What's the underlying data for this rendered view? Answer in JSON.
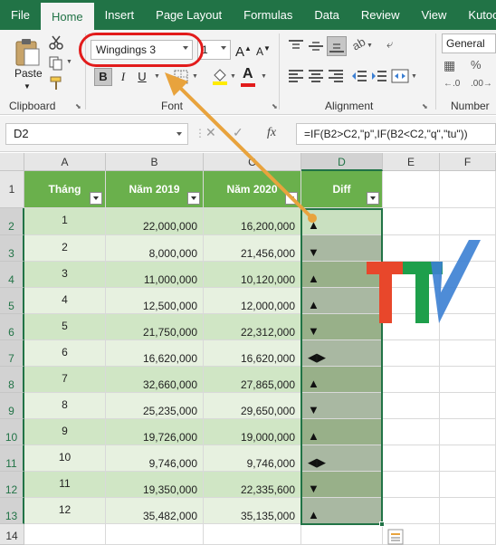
{
  "ribbon": {
    "tabs": [
      "File",
      "Home",
      "Insert",
      "Page Layout",
      "Formulas",
      "Data",
      "Review",
      "View",
      "Kutools"
    ],
    "active_tab": "Home",
    "clipboard": {
      "paste_label": "Paste",
      "group_label": "Clipboard"
    },
    "font": {
      "font_name": "Wingdings 3",
      "font_size": "1",
      "group_label": "Font",
      "bold": "B",
      "italic": "I",
      "underline": "U"
    },
    "alignment": {
      "group_label": "Alignment"
    },
    "number": {
      "format": "General",
      "group_label": "Number"
    }
  },
  "formula_bar": {
    "name_box": "D2",
    "fx": "fx",
    "formula": "=IF(B2>C2,\"p\",IF(B2<C2,\"q\",\"tu\"))"
  },
  "columns": [
    "A",
    "B",
    "C",
    "D",
    "E",
    "F"
  ],
  "selected_column": "D",
  "headers": {
    "a": "Tháng",
    "b": "Năm 2019",
    "c": "Năm 2020",
    "d": "Diff"
  },
  "row_numbers": [
    "1",
    "2",
    "3",
    "4",
    "5",
    "6",
    "7",
    "8",
    "9",
    "10",
    "11",
    "12",
    "13",
    "14"
  ],
  "rows": [
    {
      "month": "1",
      "y2019": "22,000,000",
      "y2020": "16,200,000",
      "diff": "▲"
    },
    {
      "month": "2",
      "y2019": "8,000,000",
      "y2020": "21,456,000",
      "diff": "▼"
    },
    {
      "month": "3",
      "y2019": "11,000,000",
      "y2020": "10,120,000",
      "diff": "▲"
    },
    {
      "month": "4",
      "y2019": "12,500,000",
      "y2020": "12,000,000",
      "diff": "▲"
    },
    {
      "month": "5",
      "y2019": "21,750,000",
      "y2020": "22,312,000",
      "diff": "▼"
    },
    {
      "month": "6",
      "y2019": "16,620,000",
      "y2020": "16,620,000",
      "diff": "◀▶"
    },
    {
      "month": "7",
      "y2019": "32,660,000",
      "y2020": "27,865,000",
      "diff": "▲"
    },
    {
      "month": "8",
      "y2019": "25,235,000",
      "y2020": "29,650,000",
      "diff": "▼"
    },
    {
      "month": "9",
      "y2019": "19,726,000",
      "y2020": "19,000,000",
      "diff": "▲"
    },
    {
      "month": "10",
      "y2019": "9,746,000",
      "y2020": "9,746,000",
      "diff": "◀▶"
    },
    {
      "month": "11",
      "y2019": "19,350,000",
      "y2020": "22,335,600",
      "diff": "▼"
    },
    {
      "month": "12",
      "y2019": "35,482,000",
      "y2020": "35,135,000",
      "diff": "▲"
    }
  ],
  "colors": {
    "excel_green": "#217346",
    "header_green": "#6ab04c",
    "highlight_red": "#e21b1b",
    "arrow_orange": "#e8a33d",
    "logo_red": "#e8472b",
    "logo_green": "#1e9f4b",
    "logo_blue": "#3b7fd3"
  }
}
